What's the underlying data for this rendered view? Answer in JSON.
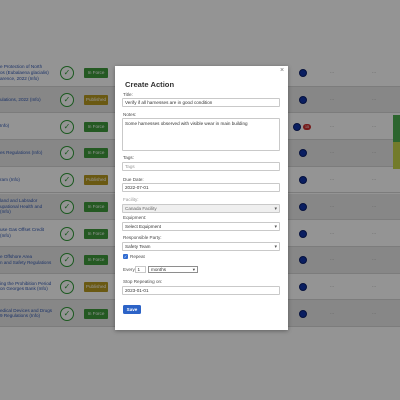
{
  "table": {
    "rows": [
      {
        "regulation": "e Protection of North\nos (Eubalaena glacialis)\narence, 2022 (Info)",
        "status": "In Force",
        "status_type": "inforce"
      },
      {
        "regulation": "ulations, 2022 (Info)",
        "status": "Published",
        "status_type": "published"
      },
      {
        "regulation": "Info)",
        "status": "In Force",
        "status_type": "inforce"
      },
      {
        "regulation": "es Regulations (Info)",
        "status": "In Force",
        "status_type": "inforce"
      },
      {
        "regulation": "ram (Info)",
        "status": "Published",
        "status_type": "published"
      },
      {
        "regulation": "land and Labrador\nupational Health and\n(Info)",
        "status": "In Force",
        "status_type": "inforce"
      },
      {
        "regulation": "use Gas Offset Credit\n(Info)",
        "status": "In Force",
        "status_type": "inforce"
      },
      {
        "regulation": "e Offshore Area\nn and Safety Regulations",
        "status": "In Force",
        "status_type": "inforce"
      },
      {
        "regulation": "ing the Prohibition Period\non Georges Bank (Info)",
        "status": "Published",
        "status_type": "published"
      },
      {
        "regulation": "edical Devices and Drugs\n9 Regulations (Info)",
        "status": "In Force",
        "status_type": "inforce"
      }
    ],
    "badge_count": "15"
  },
  "modal": {
    "title": "Create Action",
    "close_glyph": "×",
    "title_label": "Title:",
    "title_value": "Verify if all harnesses are in good condition",
    "notes_label": "Notes:",
    "notes_value": "Some harnesses observed with visible wear in main building",
    "tags_label": "Tags:",
    "tags_placeholder": "Tags",
    "due_date_label": "Due Date:",
    "due_date_value": "2022-07-01",
    "facility_label": "Facility:",
    "facility_value": "Canada Facility",
    "equipment_label": "Equipment:",
    "equipment_value": "Select Equipment",
    "responsible_label": "Responsible Party:",
    "responsible_value": "Safety Team",
    "repeat_label": "Repeat",
    "repeat_checked": true,
    "every_label": "Every",
    "every_value": "1",
    "every_unit": "months",
    "stop_label": "Stop Repeating on:",
    "stop_value": "2023-01-01",
    "save_label": "Save"
  },
  "colors": {
    "link": "#2f57b4",
    "in_force": "#3e9a3b",
    "published": "#b7991f",
    "primary_button": "#2c63c7",
    "dot": "#1235a8",
    "badge": "#cc2b2b"
  }
}
